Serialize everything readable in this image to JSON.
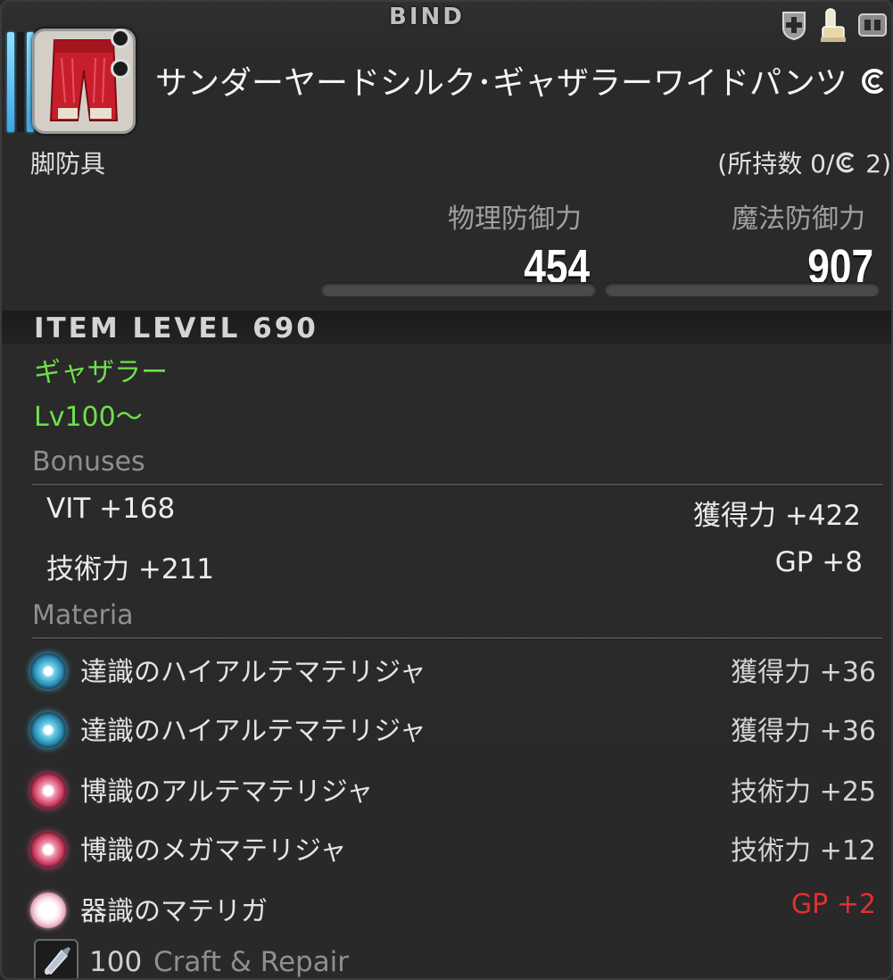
{
  "header": {
    "bind_label": "BIND",
    "icons": [
      "plus-shield-icon",
      "glamour-hand-icon",
      "equipment-menu-icon"
    ]
  },
  "item": {
    "name": "サンダーヤードシルク･ギャザラーワイドパンツ",
    "hq_icon": "hq-icon",
    "category": "脚防具",
    "owned_count": "(所持数 0/",
    "owned_count_hq": " 2)",
    "image_icon": "red-pants-icon"
  },
  "defense": {
    "physical_label": "物理防御力",
    "physical_value": "454",
    "magical_label": "魔法防御力",
    "magical_value": "907"
  },
  "item_level": "ITEM LEVEL 690",
  "class_job": "ギャザラー",
  "required_level": "Lv100～",
  "bonuses": {
    "title": "Bonuses",
    "items": [
      {
        "label": "VIT +168"
      },
      {
        "label": "獲得力 +422"
      },
      {
        "label": "技術力 +211"
      },
      {
        "label": "GP +8"
      }
    ]
  },
  "materia": {
    "title": "Materia",
    "items": [
      {
        "name": "達識のハイアルテマテリジャ",
        "stat": "獲得力 +36",
        "orb": "blue-materia-icon"
      },
      {
        "name": "達識のハイアルテマテリジャ",
        "stat": "獲得力 +36",
        "orb": "blue-materia-icon"
      },
      {
        "name": "博識のアルテマテリジャ",
        "stat": "技術力 +25",
        "orb": "red-materia-icon"
      },
      {
        "name": "博識のメガマテリジャ",
        "stat": "技術力 +12",
        "orb": "red-materia-icon"
      },
      {
        "name": "器識のマテリガ",
        "stat": "GP +2",
        "orb": "pink-materia-icon"
      }
    ]
  },
  "craft": {
    "level": "100",
    "label": "Craft & Repair",
    "icon": "craft-tool-icon"
  },
  "colors": {
    "green_text": "#6fe04a",
    "capped_stat_red": "#e03030",
    "muted_heading": "#8f8f8f"
  }
}
